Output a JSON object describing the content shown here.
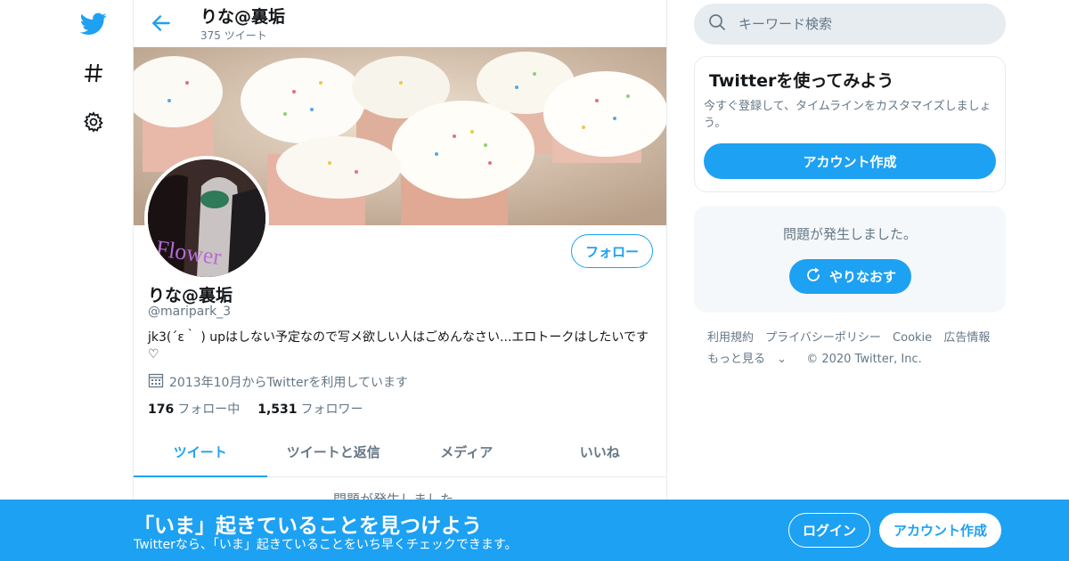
{
  "colors": {
    "accent": "#1da1f2",
    "text": "#14171a",
    "muted": "#657786",
    "border": "#e6ecf0"
  },
  "nav": {
    "icons": [
      "twitter-bird-icon",
      "hashtag-icon",
      "gear-icon"
    ]
  },
  "header": {
    "name": "りな@裏垢",
    "tweet_count": "375 ツイート"
  },
  "profile": {
    "follow_label": "フォロー",
    "name": "りな@裏垢",
    "handle": "@maripark_3",
    "bio": "jk3(´ε｀ ) upはしない予定なので写メ欲しい人はごめんなさい...エロトークはしたいです♡",
    "joined": "2013年10月からTwitterを利用しています",
    "following_count": "176",
    "following_label": "フォロー中",
    "followers_count": "1,531",
    "followers_label": "フォロワー",
    "avatar_text": "Flower"
  },
  "tabs": [
    {
      "label": "ツイート",
      "active": true
    },
    {
      "label": "ツイートと返信",
      "active": false
    },
    {
      "label": "メディア",
      "active": false
    },
    {
      "label": "いいね",
      "active": false
    }
  ],
  "main_error": "問題が発生しました。",
  "search": {
    "placeholder": "キーワード検索"
  },
  "signup_card": {
    "title": "Twitterを使ってみよう",
    "text": "今すぐ登録して、タイムラインをカスタマイズしましょう。",
    "button": "アカウント作成"
  },
  "error_card": {
    "message": "問題が発生しました。",
    "retry": "やりなおす"
  },
  "footer": {
    "links": [
      "利用規約",
      "プライバシーポリシー",
      "Cookie",
      "広告情報"
    ],
    "more": "もっと見る",
    "copyright": "© 2020 Twitter, Inc."
  },
  "bottom_bar": {
    "title": "「いま」起きていることを見つけよう",
    "subtitle": "Twitterなら、「いま」起きていることをいち早くチェックできます。",
    "login": "ログイン",
    "signup": "アカウント作成"
  }
}
